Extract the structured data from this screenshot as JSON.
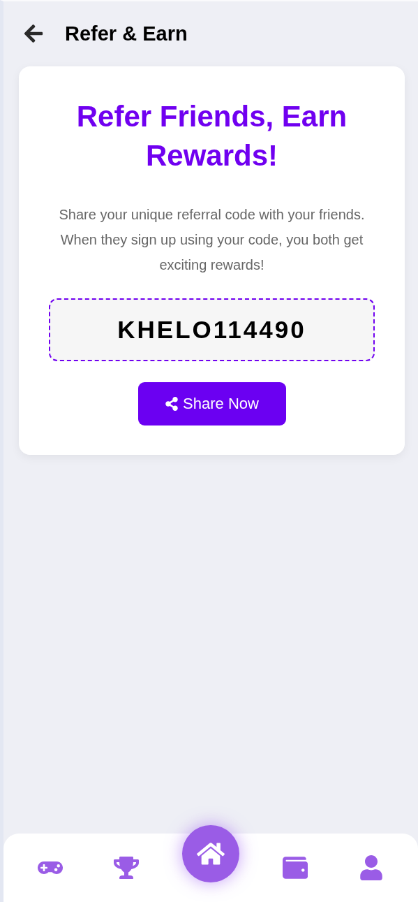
{
  "header": {
    "title": "Refer & Earn"
  },
  "card": {
    "heading": "Refer Friends, Earn Rewards!",
    "description": "Share your unique referral code with your friends. When they sign up using your code, you both get exciting rewards!",
    "code": "KHELO114490",
    "button": "Share Now"
  },
  "bottom_nav": [
    {
      "kind": "tab"
    },
    {
      "kind": "tab"
    },
    {
      "kind": "center"
    },
    {
      "kind": "tab"
    },
    {
      "kind": "tab"
    }
  ]
}
